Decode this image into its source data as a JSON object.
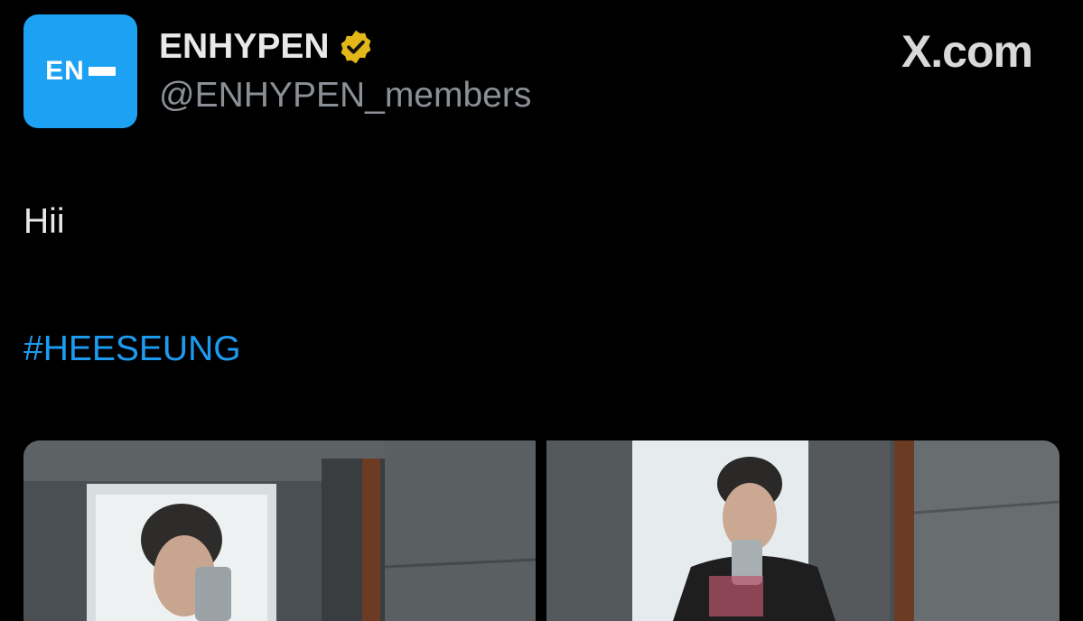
{
  "author": {
    "display_name": "ENHYPEN",
    "handle": "@ENHYPEN_members",
    "avatar_logo": "EN"
  },
  "source_label": "X.com",
  "tweet": {
    "text": "Hii",
    "hashtag": "#HEESEUNG"
  },
  "media": [
    {
      "description_icon": "mirror-selfie-photo"
    },
    {
      "description_icon": "mirror-selfie-photo"
    }
  ],
  "colors": {
    "background": "#000000",
    "text": "#e7e9ea",
    "handle": "#8b9096",
    "link": "#1d9bf0",
    "avatar_bg": "#1da1f2",
    "verified_gold": "#e2b719"
  }
}
